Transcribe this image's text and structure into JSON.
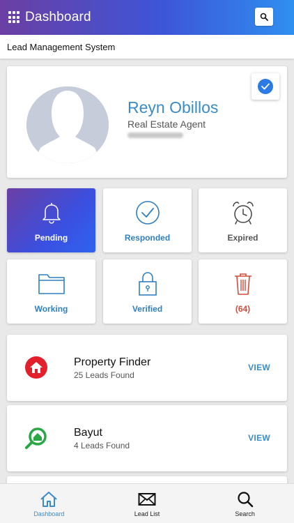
{
  "appbar": {
    "title": "Dashboard",
    "icons": [
      "grid-menu-icon",
      "search-icon"
    ]
  },
  "subbar": {
    "title": "Lead Management System"
  },
  "profile": {
    "name": "Reyn Obillos",
    "role": "Real Estate Agent",
    "verified_icon": "check-circle-icon"
  },
  "tiles": [
    {
      "label": "Pending",
      "icon": "bell-icon",
      "active": true
    },
    {
      "label": "Responded",
      "icon": "check-circle-icon"
    },
    {
      "label": "Expired",
      "icon": "alarm-clock-icon"
    },
    {
      "label": "Working",
      "icon": "folder-icon"
    },
    {
      "label": "Verified",
      "icon": "lock-icon"
    },
    {
      "label": "(64)",
      "icon": "trash-icon"
    }
  ],
  "sources": [
    {
      "title": "Property Finder",
      "subtitle": "25 Leads Found",
      "action": "VIEW",
      "icon": "property-finder-logo-icon"
    },
    {
      "title": "Bayut",
      "subtitle": "4 Leads Found",
      "action": "VIEW",
      "icon": "bayut-logo-icon"
    }
  ],
  "bottom_nav": [
    {
      "label": "Dashboard",
      "icon": "home-icon",
      "active": true
    },
    {
      "label": "Lead List",
      "icon": "mail-icon"
    },
    {
      "label": "Search",
      "icon": "search-icon"
    }
  ],
  "colors": {
    "accent": "#3a8cc9",
    "gradient_start": "#6b3fa3",
    "gradient_end": "#2f8ff0",
    "danger": "#d24b3a"
  }
}
